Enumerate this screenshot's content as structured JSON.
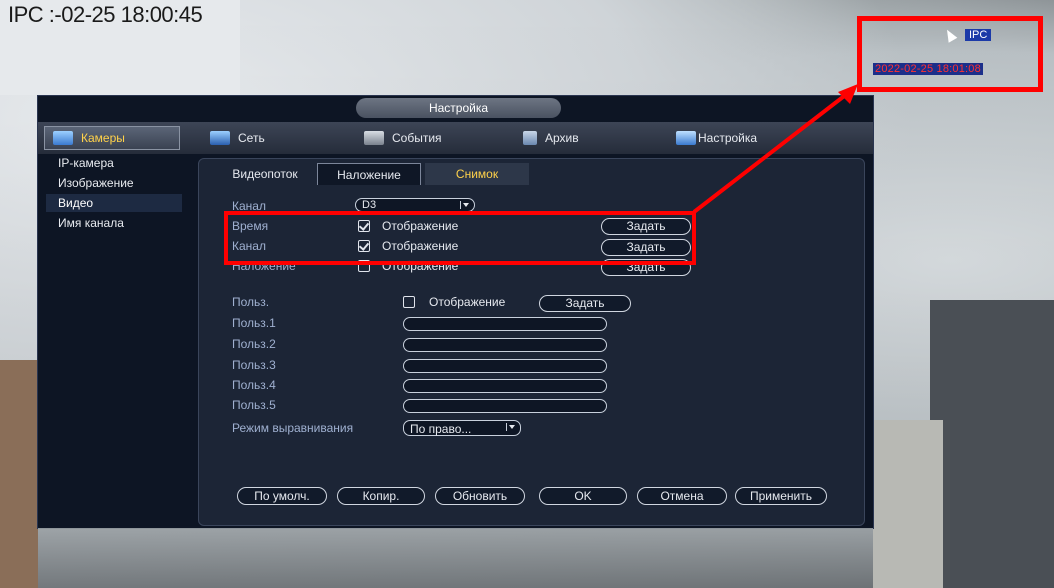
{
  "osd": {
    "top_left": "IPC :-02-25 18:00:45"
  },
  "inset": {
    "name": "IPC",
    "time": "2022-02-25 18:01:08"
  },
  "dialog": {
    "title": "Настройка",
    "topbar": [
      {
        "label": "Камеры",
        "icon": "camera-icon"
      },
      {
        "label": "Сеть",
        "icon": "network-icon"
      },
      {
        "label": "События",
        "icon": "events-icon"
      },
      {
        "label": "Архив",
        "icon": "archive-icon"
      },
      {
        "label": "Настройка",
        "icon": "settings-icon"
      }
    ],
    "sidebar": [
      "IP-камера",
      "Изображение",
      "Видео",
      "Имя канала"
    ],
    "tabs": [
      "Видеопоток",
      "Наложение",
      "Снимок"
    ],
    "form": {
      "channel_label": "Канал",
      "channel_value": "D3",
      "rows": [
        {
          "label": "Время",
          "check": "Отображение",
          "button": "Задать",
          "checked": true
        },
        {
          "label": "Канал",
          "check": "Отображение",
          "button": "Задать",
          "checked": true
        },
        {
          "label": "Наложение",
          "check": "Отображение",
          "button": "Задать",
          "checked": false
        }
      ],
      "user_label": "Польз.",
      "user_check": "Отображение",
      "user_button": "Задать",
      "user_fields": [
        "Польз.1",
        "Польз.2",
        "Польз.3",
        "Польз.4",
        "Польз.5"
      ],
      "align_label": "Режим выравнивания",
      "align_value": "По право..."
    },
    "buttons": [
      "По умолч.",
      "Копир.",
      "Обновить",
      "OK",
      "Отмена",
      "Применить"
    ]
  },
  "colors": {
    "highlight": "#ff0000",
    "active_tab": "#ffd24a"
  }
}
